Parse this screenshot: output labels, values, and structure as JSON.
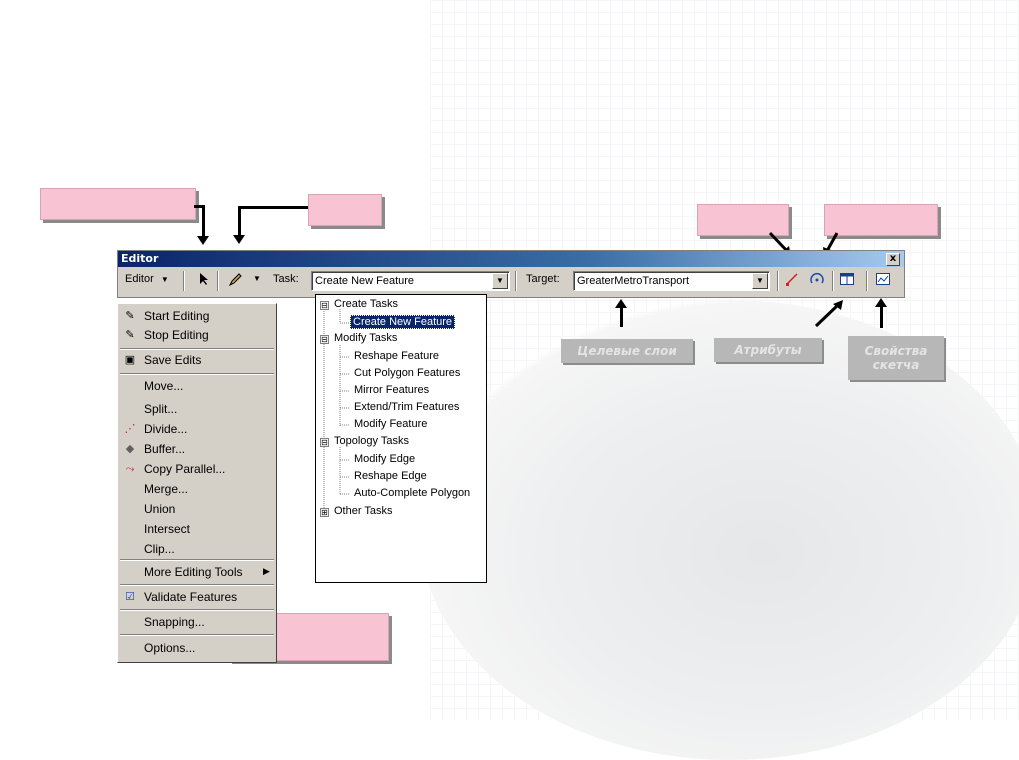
{
  "window": {
    "title": "Editor",
    "close_glyph": "x"
  },
  "toolbar": {
    "editor_menu_label": "Editor",
    "task_label": "Task:",
    "task_value": "Create New Feature",
    "target_label": "Target:",
    "target_value": "GreaterMetroTransport",
    "icons": [
      "pointer-arrow-icon",
      "sketch-pencil-icon",
      "sketch-tool-icon",
      "rotate-tool-icon",
      "attributes-icon",
      "sketch-properties-icon"
    ]
  },
  "menu": {
    "items": [
      {
        "label": "Start Editing",
        "icon": "start-editing-icon"
      },
      {
        "label": "Stop Editing",
        "icon": "stop-editing-icon"
      },
      {
        "label": "Save Edits",
        "icon": "save-edits-icon"
      },
      {
        "label": "Move..."
      },
      {
        "label": "Split..."
      },
      {
        "label": "Divide...",
        "icon": "divide-icon"
      },
      {
        "label": "Buffer...",
        "icon": "buffer-icon"
      },
      {
        "label": "Copy Parallel...",
        "icon": "copy-parallel-icon"
      },
      {
        "label": "Merge..."
      },
      {
        "label": "Union"
      },
      {
        "label": "Intersect"
      },
      {
        "label": "Clip..."
      },
      {
        "label": "More Editing Tools"
      },
      {
        "label": "Validate Features",
        "icon": "validate-icon"
      },
      {
        "label": "Snapping..."
      },
      {
        "label": "Options..."
      }
    ]
  },
  "tasks": {
    "groups": [
      {
        "label": "Create Tasks",
        "expander": "⊟",
        "items": [
          "Create New Feature"
        ]
      },
      {
        "label": "Modify Tasks",
        "expander": "⊟",
        "items": [
          "Reshape Feature",
          "Cut Polygon Features",
          "Mirror Features",
          "Extend/Trim Features",
          "Modify Feature"
        ]
      },
      {
        "label": "Topology Tasks",
        "expander": "⊟",
        "items": [
          "Modify Edge",
          "Reshape Edge",
          "Auto-Complete Polygon"
        ]
      },
      {
        "label": "Other Tasks",
        "expander": "⊞",
        "items": []
      }
    ],
    "selected": "Create New Feature"
  },
  "annotations": {
    "target_layers": "Целевые слои",
    "attributes": "Атрибуты",
    "sketch_properties": "Свойства скетча"
  },
  "colors": {
    "pink_callout": "#f8c3d3",
    "titlebar_start": "#0a246a",
    "grey_label": "#b7b7b7"
  }
}
